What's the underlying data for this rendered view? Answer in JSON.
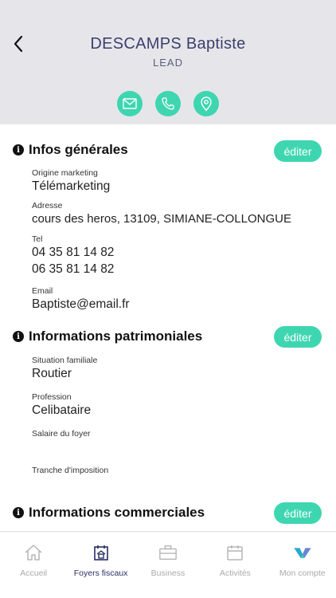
{
  "header": {
    "name": "DESCAMPS Baptiste",
    "status": "LEAD",
    "actions": [
      {
        "icon": "mail-icon"
      },
      {
        "icon": "phone-icon"
      },
      {
        "icon": "location-pin-icon"
      }
    ]
  },
  "sections": {
    "general": {
      "title": "Infos générales",
      "edit_label": "éditer",
      "fields": {
        "origin_label": "Origine marketing",
        "origin_value": "Télémarketing",
        "address_label": "Adresse",
        "address_value": "cours des heros, 13109, SIMIANE-COLLONGUE",
        "tel_label": "Tel",
        "tel_value_1": "04 35 81 14 82",
        "tel_value_2": "06 35 81 14 82",
        "email_label": "Email",
        "email_value": "Baptiste@email.fr"
      }
    },
    "patrimonial": {
      "title": "Informations patrimoniales",
      "edit_label": "éditer",
      "fields": {
        "family_label": "Situation familiale",
        "family_value": "Routier",
        "profession_label": "Profession",
        "profession_value": "Celibataire",
        "salary_label": "Salaire du foyer",
        "salary_value": "",
        "tax_label": "Tranche d'imposition",
        "tax_value": ""
      }
    },
    "commercial": {
      "title": "Informations commerciales",
      "edit_label": "éditer"
    }
  },
  "tabbar": {
    "tabs": [
      {
        "label": "Accueil",
        "icon": "home-icon",
        "active": false
      },
      {
        "label": "Foyers fiscaux",
        "icon": "household-icon",
        "active": true
      },
      {
        "label": "Business",
        "icon": "briefcase-icon",
        "active": false
      },
      {
        "label": "Activités",
        "icon": "calendar-icon",
        "active": false
      },
      {
        "label": "Mon compte",
        "icon": "brand-logo-icon",
        "active": false
      }
    ]
  },
  "colors": {
    "accent": "#3ed6b0",
    "header_bg": "#e6e6ea",
    "title": "#3b3f6e",
    "tab_active": "#2a2f66",
    "tab_inactive": "#aaaaaa"
  }
}
